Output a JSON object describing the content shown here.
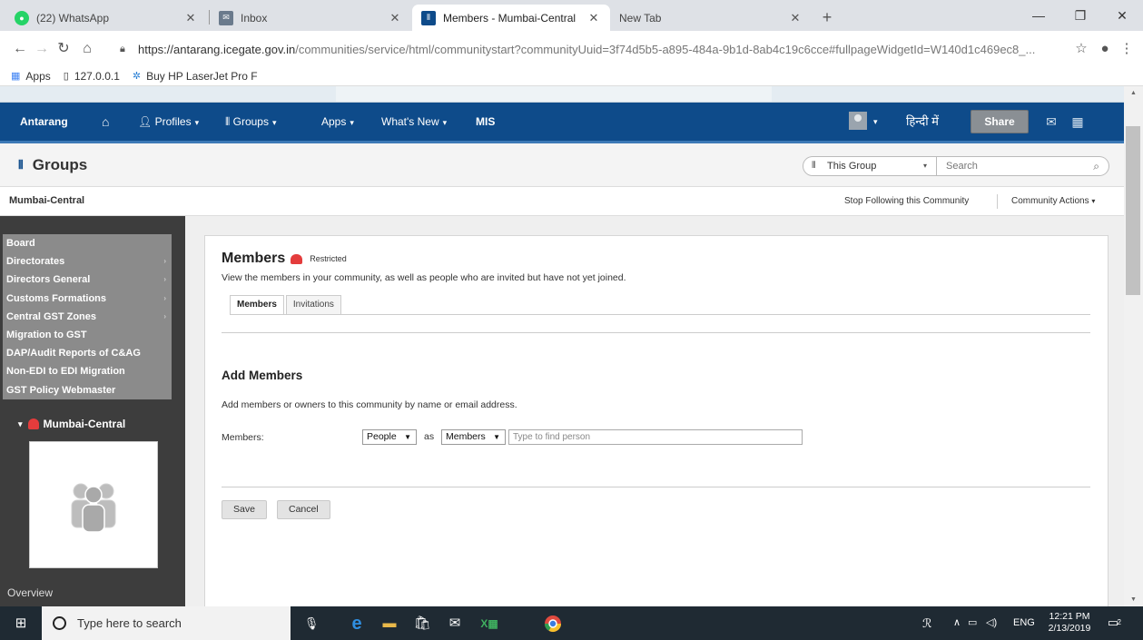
{
  "browser": {
    "tabs": [
      {
        "label": "(22) WhatsApp",
        "active": false,
        "icon": "whatsapp-icon",
        "color": "#25d366"
      },
      {
        "label": "Inbox",
        "active": false,
        "icon": "mail-icon",
        "color": "#6a7a8c"
      },
      {
        "label": "Members - Mumbai-Central",
        "active": true,
        "icon": "groups-icon",
        "color": "#0e4b8a"
      },
      {
        "label": "New Tab",
        "active": false,
        "icon": "",
        "color": ""
      }
    ],
    "url_host": "https://antarang.icegate.gov.in",
    "url_path": "/communities/service/html/communitystart?communityUuid=3f74d5b5-a895-484a-9b1d-8ab4c19c6cce#fullpageWidgetId=W140d1c469ec8_...",
    "bookmarks": [
      "Apps",
      "127.0.0.1",
      "Buy HP LaserJet Pro F"
    ]
  },
  "app": {
    "nav": {
      "brand": "Antarang",
      "profiles": "Profiles",
      "groups": "Groups",
      "apps": "Apps",
      "whats_new": "What's New",
      "mis": "MIS",
      "language": "हिन्दी में",
      "share": "Share"
    },
    "header": {
      "title": "Groups",
      "scope": "This Group",
      "search_placeholder": "Search"
    },
    "subbar": {
      "community": "Mumbai-Central",
      "stop_following": "Stop Following this Community",
      "community_actions": "Community Actions"
    },
    "sidebar": {
      "items": [
        {
          "label": "Board",
          "has_sub": false
        },
        {
          "label": "Directorates",
          "has_sub": true
        },
        {
          "label": "Directors General",
          "has_sub": true
        },
        {
          "label": "Customs Formations",
          "has_sub": true
        },
        {
          "label": "Central GST Zones",
          "has_sub": true
        },
        {
          "label": "Migration to GST",
          "has_sub": false
        },
        {
          "label": "DAP/Audit Reports of C&AG",
          "has_sub": false
        },
        {
          "label": "Non-EDI to EDI Migration",
          "has_sub": false
        },
        {
          "label": "GST Policy Webmaster",
          "has_sub": false
        }
      ],
      "community_title": "Mumbai-Central",
      "overview": "Overview"
    },
    "main": {
      "title": "Members",
      "restricted": "Restricted",
      "description": "View the members in your community, as well as people who are invited but have not yet joined.",
      "tabs": [
        "Members",
        "Invitations"
      ],
      "add_title": "Add Members",
      "add_description": "Add members or owners to this community by name or email address.",
      "members_label": "Members:",
      "type_select": "People",
      "as_label": "as",
      "role_select": "Members",
      "find_placeholder": "Type to find person",
      "save": "Save",
      "cancel": "Cancel"
    }
  },
  "taskbar": {
    "search_placeholder": "Type here to search",
    "lang": "ENG",
    "time": "12:21 PM",
    "date": "2/13/2019",
    "notifications": "2"
  }
}
